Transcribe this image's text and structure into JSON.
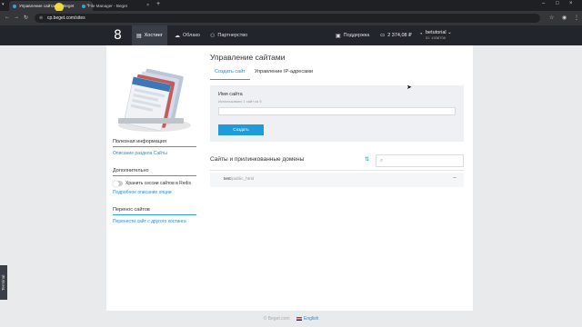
{
  "browser": {
    "tabs": [
      {
        "title": "Управление сайтами | Beget"
      },
      {
        "title": "File Manager - Beget"
      }
    ],
    "new_tab": "+",
    "url": "cp.beget.com/sites"
  },
  "header": {
    "logo": "8",
    "nav": [
      {
        "label": "Хостинг",
        "icon": "server-icon"
      },
      {
        "label": "Облако",
        "icon": "cloud-icon"
      },
      {
        "label": "Партнерство",
        "icon": "handshake-icon"
      }
    ],
    "support": "Поддержка",
    "balance": "2 374,08 ₽",
    "username": "betutorial",
    "user_id": "ID: 1938708"
  },
  "sidebar": {
    "useful_info": {
      "title": "Полезная информация",
      "link": "Описание раздела Сайты"
    },
    "extra": {
      "title": "Дополнительно",
      "toggle_label": "Хранить сессии сайтов в Redis",
      "link": "Подробное описание опции"
    },
    "transfer": {
      "title": "Перенос сайтов",
      "link": "Перенести сайт с другого хостинга"
    }
  },
  "main": {
    "title": "Управление сайтами",
    "tabs": [
      "Создать сайт",
      "Управление IP-адресами"
    ],
    "create": {
      "label": "Имя сайта",
      "used": "Использовано 1 сайт из 5",
      "input_value": "",
      "button": "Создать"
    },
    "sites_title": "Сайты и прилинкованные домены",
    "sites": [
      {
        "name": "test",
        "path": "/public_html"
      }
    ]
  },
  "footer": {
    "copyright": "© Beget.com",
    "language": "English"
  },
  "terminal_tab": "Terminal",
  "colors": {
    "accent": "#1e9bd8",
    "header_bg": "#22252b",
    "page_bg": "#e9eaec"
  }
}
